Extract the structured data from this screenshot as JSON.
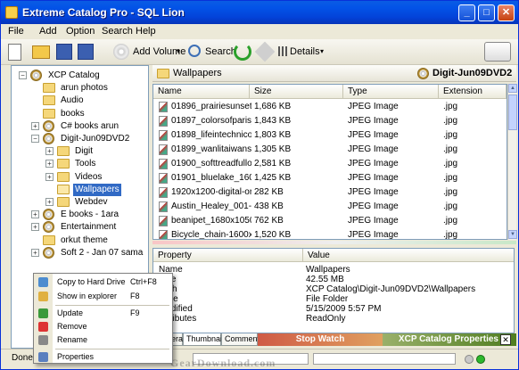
{
  "window": {
    "title": "Extreme Catalog Pro - SQL Lion",
    "min": "_",
    "max": "□",
    "close": "✕"
  },
  "menu": [
    "File",
    "Add",
    "Option",
    "Search",
    "Help"
  ],
  "toolbar": {
    "add_volume": "Add Volume",
    "search": "Search",
    "details": "Details",
    "dropdown_arrow": "▾"
  },
  "tree": [
    {
      "label": "XCP Catalog",
      "level": 0,
      "icon": "catalog-icon",
      "expander": "−"
    },
    {
      "label": "arun photos",
      "level": 1,
      "icon": "folder-icon",
      "expander": ""
    },
    {
      "label": "Audio",
      "level": 1,
      "icon": "folder-icon",
      "expander": ""
    },
    {
      "label": "books",
      "level": 1,
      "icon": "folder-icon",
      "expander": ""
    },
    {
      "label": "C# books arun",
      "level": 1,
      "icon": "cd-icon",
      "expander": "+"
    },
    {
      "label": "Digit-Jun09DVD2",
      "level": 1,
      "icon": "cd-icon",
      "expander": "−"
    },
    {
      "label": "Digit",
      "level": 2,
      "icon": "folder-icon",
      "expander": "+"
    },
    {
      "label": "Tools",
      "level": 2,
      "icon": "folder-icon",
      "expander": "+"
    },
    {
      "label": "Videos",
      "level": 2,
      "icon": "folder-icon",
      "expander": "+"
    },
    {
      "label": "Wallpapers",
      "level": 2,
      "icon": "folder-open-icon",
      "expander": "",
      "selected": true
    },
    {
      "label": "Webdev",
      "level": 2,
      "icon": "folder-icon",
      "expander": "+"
    },
    {
      "label": "E books - 1ara",
      "level": 1,
      "icon": "cd-icon",
      "expander": "+"
    },
    {
      "label": "Entertainment",
      "level": 1,
      "icon": "cd-icon",
      "expander": "+"
    },
    {
      "label": "orkut theme",
      "level": 1,
      "icon": "folder-icon",
      "expander": ""
    },
    {
      "label": "Soft 2 - Jan 07 sama",
      "level": 1,
      "icon": "cd-icon",
      "expander": "+"
    }
  ],
  "path": {
    "folder": "Wallpapers",
    "volume": "Digit-Jun09DVD2"
  },
  "list": {
    "columns": [
      "Name",
      "Size",
      "Type",
      "Extension"
    ],
    "rows": [
      [
        "01896_prairiesunset_16...",
        "1,686 KB",
        "JPEG Image",
        ".jpg"
      ],
      [
        "01897_colorsofparis_16...",
        "1,843 KB",
        "JPEG Image",
        ".jpg"
      ],
      [
        "01898_lifeintechnicolor...",
        "1,803 KB",
        "JPEG Image",
        ".jpg"
      ],
      [
        "01899_wanlitaiwansunri...",
        "1,305 KB",
        "JPEG Image",
        ".jpg"
      ],
      [
        "01900_softtreadfullofmo...",
        "2,581 KB",
        "JPEG Image",
        ".jpg"
      ],
      [
        "01901_bluelake_1600x...",
        "1,425 KB",
        "JPEG Image",
        ".jpg"
      ],
      [
        "1920x1200-digital-orchi...",
        "282 KB",
        "JPEG Image",
        ".jpg"
      ],
      [
        "Austin_Healey_001-144...",
        "438 KB",
        "JPEG Image",
        ".jpg"
      ],
      [
        "beanipet_1680x1050.jpg",
        "762 KB",
        "JPEG Image",
        ".jpg"
      ],
      [
        "Bicycle_chain-1600x12...",
        "1,520 KB",
        "JPEG Image",
        ".jpg"
      ]
    ]
  },
  "properties": {
    "columns": [
      "Property",
      "Value"
    ],
    "rows": [
      [
        "Name",
        "Wallpapers"
      ],
      [
        "Size",
        "42.55 MB"
      ],
      [
        "Path",
        "XCP Catalog\\Digit-Jun09DVD2\\Wallpapers"
      ],
      [
        "Type",
        "File Folder"
      ],
      [
        "Modified",
        "5/15/2009 5:57 PM"
      ],
      [
        "Attributes",
        "ReadOnly"
      ]
    ]
  },
  "tabs": [
    "General",
    "Thumbnail",
    "Comments"
  ],
  "stop_watch": "Stop Watch",
  "xcp_properties": "XCP Catalog Properties",
  "xcp_close": "✕",
  "status": {
    "text": "Done"
  },
  "context_menu": [
    {
      "label": "Copy to Hard Drive",
      "shortcut": "Ctrl+F8",
      "icon": "copy-drive-icon",
      "color": "#4d8ccf"
    },
    {
      "label": "Show in explorer",
      "shortcut": "F8",
      "icon": "explorer-icon",
      "color": "#e0b040"
    },
    {
      "label": "Update",
      "shortcut": "F9",
      "icon": "update-icon",
      "color": "#3b9a3b"
    },
    {
      "label": "Remove",
      "shortcut": "",
      "icon": "remove-icon",
      "color": "#d33"
    },
    {
      "label": "Rename",
      "shortcut": "",
      "icon": "rename-icon",
      "color": "#888"
    },
    {
      "label": "Properties",
      "shortcut": "",
      "icon": "properties-icon",
      "color": "#5a7fbf"
    }
  ],
  "watermark": "GearDownload.com"
}
